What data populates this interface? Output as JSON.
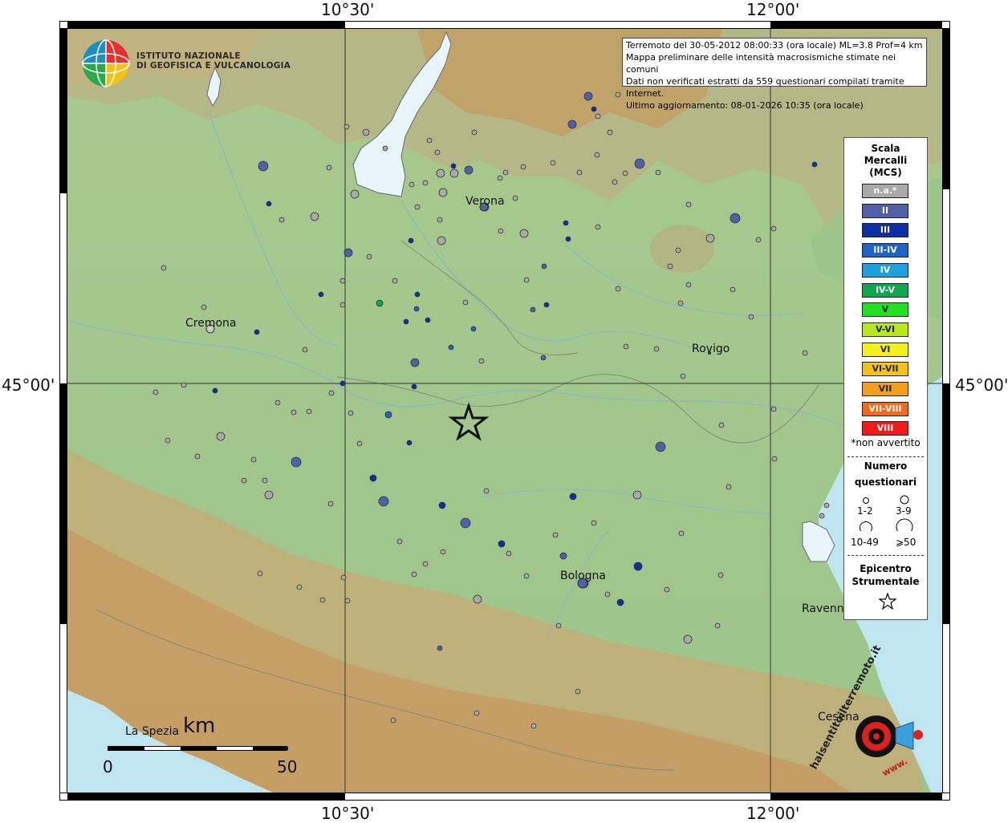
{
  "header": {
    "info_line1": "Terremoto del 30-05-2012 08:00:33 (ora locale) ML=3.8 Prof=4 km",
    "info_line2": "Mappa preliminare delle intensità macrosismiche stimate nei comuni",
    "info_line3": "Dati non verificati estratti da 559 questionari compilati tramite Internet.",
    "info_line4": "Ultimo aggiornamento: 08-01-2026 10:35 (ora locale)"
  },
  "logo": {
    "line1": "ISTITUTO NAZIONALE",
    "line2": "DI GEOFISICA E VULCANOLOGIA"
  },
  "axes": {
    "top_left": "10°30'",
    "top_right": "12°00'",
    "bottom_left": "10°30'",
    "bottom_right": "12°00'",
    "left_lat": "45°00'",
    "right_lat": "45°00'"
  },
  "cities": {
    "verona": "Verona",
    "cremona": "Cremona",
    "rovigo": "Rovigo",
    "bologna": "Bologna",
    "ravenna": "Ravenn",
    "cesena": "Cesena",
    "la_spezia": "La Spezia"
  },
  "scale_bar": {
    "unit": "km",
    "start": "0",
    "end": "50"
  },
  "legend": {
    "title1": "Scala",
    "title2": "Mercalli",
    "title3": "(MCS)",
    "classes": [
      {
        "label": "n.a.*",
        "color": "#a9a9a9"
      },
      {
        "label": "II",
        "color": "#5060a8"
      },
      {
        "label": "III",
        "color": "#0d2fa6"
      },
      {
        "label": "III-IV",
        "color": "#1f62c8"
      },
      {
        "label": "IV",
        "color": "#1ea0e0"
      },
      {
        "label": "IV-V",
        "color": "#10a650"
      },
      {
        "label": "V",
        "color": "#22e022"
      },
      {
        "label": "V-VI",
        "color": "#b8e81a"
      },
      {
        "label": "VI",
        "color": "#f2f21a"
      },
      {
        "label": "VI-VII",
        "color": "#f2c21a"
      },
      {
        "label": "VII",
        "color": "#f2a01a"
      },
      {
        "label": "VII-VIII",
        "color": "#f26a1a"
      },
      {
        "label": "VIII",
        "color": "#f21a1a"
      }
    ],
    "not_felt": "*non avvertito",
    "count_title1": "Numero",
    "count_title2": "questionari",
    "sizes": [
      "1-2",
      "3-9",
      "10-49",
      "⩾50"
    ],
    "epicenter_title1": "Epicentro",
    "epicenter_title2": "Strumentale"
  },
  "watermark": {
    "text": "haisentitoilterremoto.it",
    "www": "www."
  }
}
